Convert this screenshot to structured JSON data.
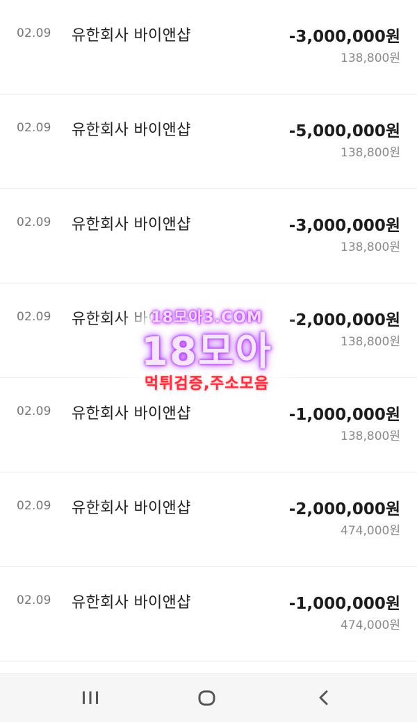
{
  "transactions": [
    {
      "date": "02.09",
      "merchant": "유한회사 바이앤샵",
      "amount": "-3,000,000원",
      "balance": "138,800원"
    },
    {
      "date": "02.09",
      "merchant": "유한회사 바이앤샵",
      "amount": "-5,000,000원",
      "balance": "138,800원"
    },
    {
      "date": "02.09",
      "merchant": "유한회사 바이앤샵",
      "amount": "-3,000,000원",
      "balance": "138,800원"
    },
    {
      "date": "02.09",
      "merchant": "유한회사 바이앤샵",
      "amount": "-2,000,000원",
      "balance": "138,800원"
    },
    {
      "date": "02.09",
      "merchant": "유한회사 바이앤샵",
      "amount": "-1,000,000원",
      "balance": "138,800원"
    },
    {
      "date": "02.09",
      "merchant": "유한회사 바이앤샵",
      "amount": "-2,000,000원",
      "balance": "474,000원"
    },
    {
      "date": "02.09",
      "merchant": "유한회사 바이앤샵",
      "amount": "-1,000,000원",
      "balance": "474,000원"
    }
  ],
  "watermark": {
    "domain": "18모아3.COM",
    "title": "18모아",
    "subtitle": "먹튀검증,주소모음"
  },
  "navbar": {
    "icons": [
      "recents-icon",
      "home-icon",
      "back-icon"
    ]
  },
  "colors": {
    "amount": "#1c1c1c",
    "balance": "#8a8a8a",
    "date": "#777777",
    "watermark_glow": "#b02cff",
    "watermark_sub": "#ff2a3a",
    "navbar_bg": "#f6f6f6"
  }
}
